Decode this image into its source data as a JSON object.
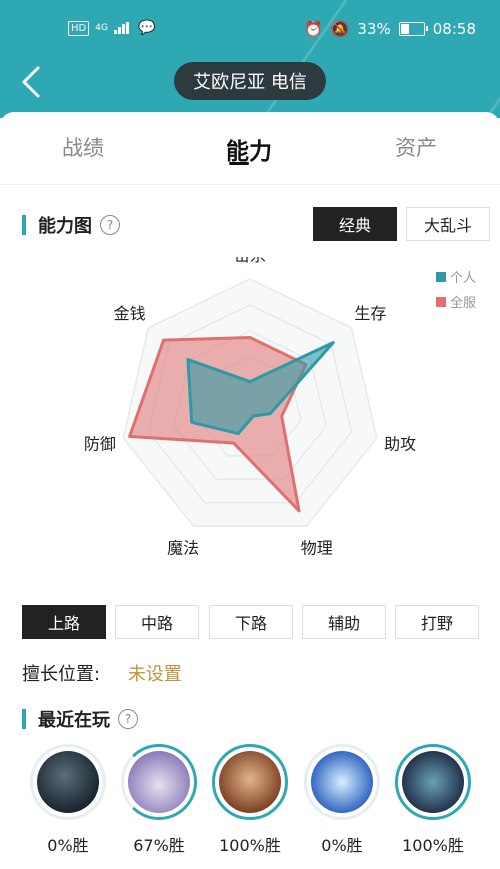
{
  "status_bar": {
    "network": "HD",
    "signal_label": "4G",
    "battery": "33%",
    "time": "08:58"
  },
  "header": {
    "title": "艾欧尼亚 电信"
  },
  "tabs": [
    {
      "label": "战绩",
      "active": false
    },
    {
      "label": "能力",
      "active": true
    },
    {
      "label": "资产",
      "active": false
    }
  ],
  "ability": {
    "title": "能力图",
    "modes": [
      {
        "label": "经典",
        "active": true
      },
      {
        "label": "大乱斗",
        "active": false
      }
    ],
    "legend": [
      {
        "label": "个人",
        "color": "#2e9aa5"
      },
      {
        "label": "全服",
        "color": "#e07070"
      }
    ]
  },
  "chart_data": {
    "type": "radar",
    "axes": [
      "击杀",
      "生存",
      "助攻",
      "物理",
      "魔法",
      "防御",
      "金钱"
    ],
    "series": [
      {
        "name": "个人",
        "values": [
          0.21,
          0.82,
          0.16,
          0.06,
          0.21,
          0.46,
          0.61
        ]
      },
      {
        "name": "全服",
        "values": [
          0.55,
          0.55,
          0.25,
          0.87,
          0.29,
          0.95,
          0.85
        ]
      }
    ],
    "range": [
      0,
      1
    ]
  },
  "lanes": [
    {
      "label": "上路",
      "active": true
    },
    {
      "label": "中路",
      "active": false
    },
    {
      "label": "下路",
      "active": false
    },
    {
      "label": "辅助",
      "active": false
    },
    {
      "label": "打野",
      "active": false
    }
  ],
  "position": {
    "label": "擅长位置:",
    "value": "未设置"
  },
  "recent": {
    "title": "最近在玩",
    "heroes": [
      {
        "winrate": "0%胜",
        "progress": 0,
        "avatar": "dark-armored-champion"
      },
      {
        "winrate": "67%胜",
        "progress": 0.67,
        "avatar": "yordle-cat-champion"
      },
      {
        "winrate": "100%胜",
        "progress": 1,
        "avatar": "warrior-woman-champion"
      },
      {
        "winrate": "0%胜",
        "progress": 0,
        "avatar": "ice-spirit-champion"
      },
      {
        "winrate": "100%胜",
        "progress": 1,
        "avatar": "shadow-creature-champion"
      }
    ]
  }
}
